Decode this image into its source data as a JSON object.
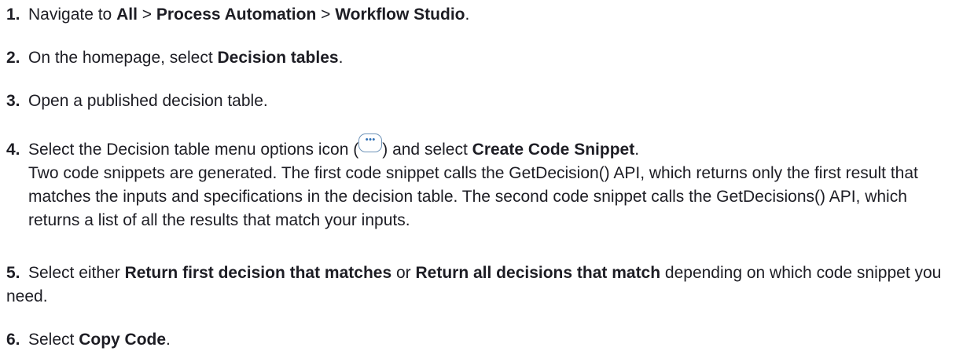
{
  "steps": [
    {
      "number": "1.",
      "parts": [
        "Navigate to ",
        "All",
        " > ",
        "Process Automation",
        " > ",
        "Workflow Studio",
        "."
      ]
    },
    {
      "number": "2.",
      "parts": [
        "On the homepage, select ",
        "Decision tables",
        "."
      ]
    },
    {
      "number": "3.",
      "parts": [
        "Open a published decision table."
      ]
    },
    {
      "number": "4.",
      "parts": [
        "Select the Decision table menu options icon (",
        ") and select ",
        "Create Code Snippet",
        "."
      ],
      "icon": "more-options-icon",
      "description": "Two code snippets are generated. The first code snippet calls the GetDecision() API, which returns only the first result that matches the inputs and specifications in the decision table. The second code snippet calls the GetDecisions() API, which returns a list of all the results that match your inputs."
    },
    {
      "number": "5.",
      "parts": [
        "Select either ",
        "Return first decision that matches",
        " or ",
        "Return all decisions that match",
        " depending on which code snippet you need."
      ]
    },
    {
      "number": "6.",
      "parts": [
        "Select ",
        "Copy Code",
        "."
      ]
    }
  ]
}
